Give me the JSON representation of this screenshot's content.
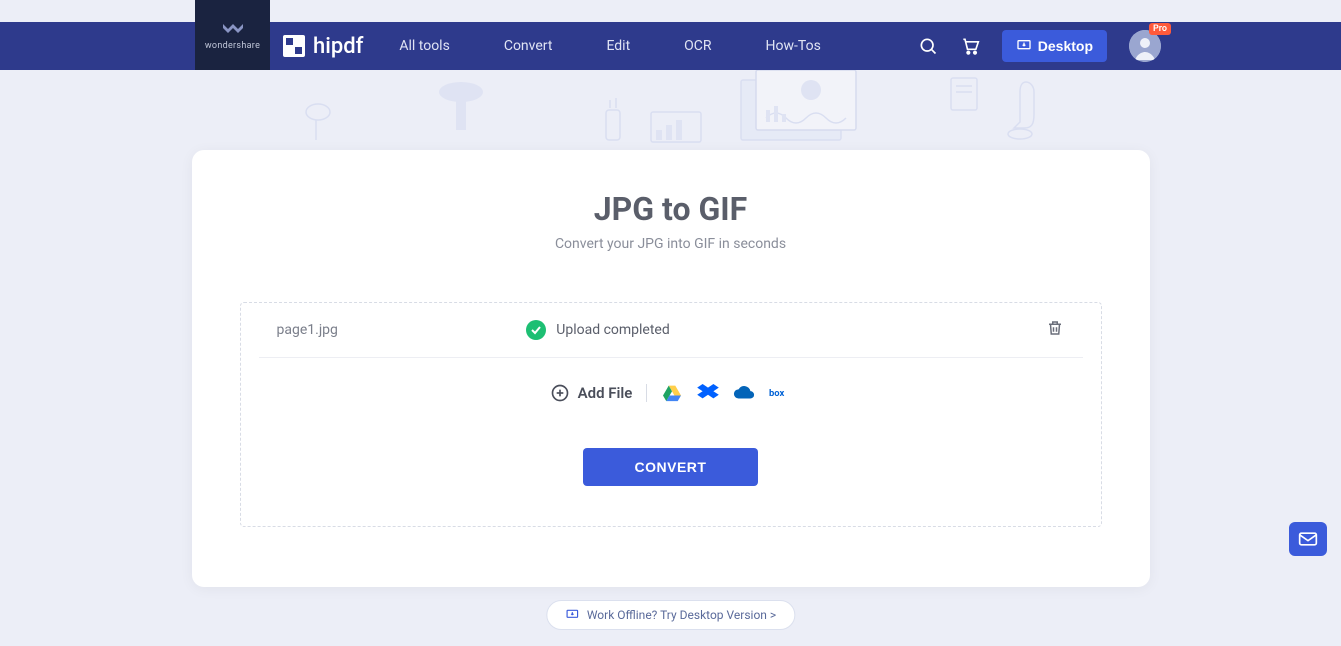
{
  "brand": {
    "parent": "wondershare",
    "product": "hipdf"
  },
  "nav": {
    "items": [
      "All tools",
      "Convert",
      "Edit",
      "OCR",
      "How-Tos"
    ]
  },
  "header": {
    "desktop": "Desktop",
    "pro_badge": "Pro"
  },
  "page": {
    "title": "JPG to GIF",
    "subtitle": "Convert your JPG into GIF in seconds"
  },
  "file": {
    "name": "page1.jpg",
    "status": "Upload completed"
  },
  "actions": {
    "add_file": "Add File",
    "convert": "CONVERT",
    "offline": "Work Offline? Try Desktop Version >"
  },
  "cloud_sources": [
    "google-drive",
    "dropbox",
    "onedrive",
    "box"
  ]
}
